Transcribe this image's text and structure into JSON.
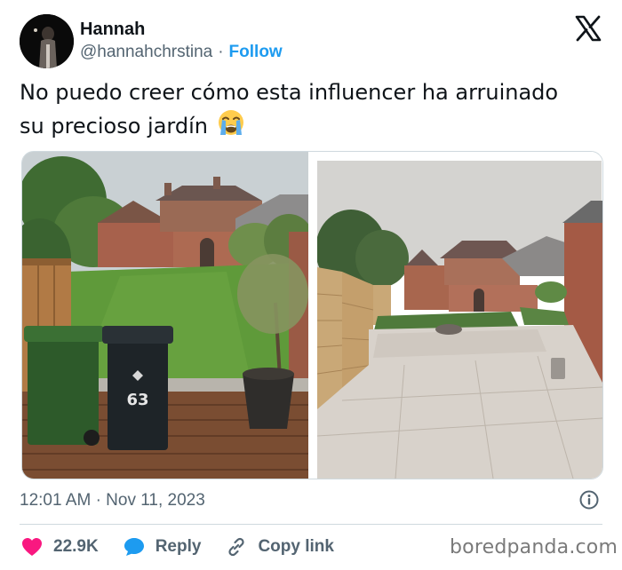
{
  "user": {
    "name": "Hannah",
    "handle": "@hannahchrstina",
    "separator": "·",
    "follow_label": "Follow"
  },
  "tweet": {
    "text_line1": "No puedo creer cómo esta influencer ha arruinado",
    "text_line2": "su precioso jardín",
    "emoji": "loudly-crying-face",
    "bin_number": "63"
  },
  "meta": {
    "time": "12:01 AM",
    "separator": "·",
    "date": "Nov 11, 2023"
  },
  "actions": {
    "likes": "22.9K",
    "reply_label": "Reply",
    "copy_link_label": "Copy link"
  },
  "watermark": "boredpanda.com",
  "icons": {
    "platform": "x-logo-icon",
    "like": "heart-icon",
    "reply": "speech-bubble-icon",
    "copy": "link-icon",
    "info": "info-icon"
  },
  "colors": {
    "accent": "#1d9bf0",
    "like": "#f91880",
    "text": "#0f1419",
    "muted": "#536471",
    "border": "#cfd9de"
  }
}
